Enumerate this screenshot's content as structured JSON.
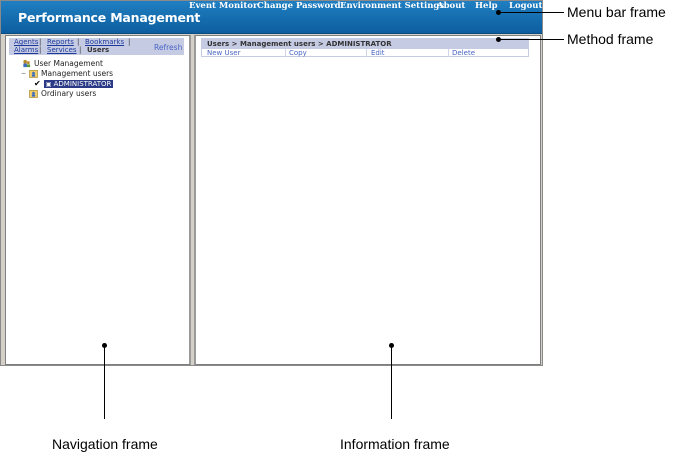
{
  "menubar": {
    "app_title": "Performance Management",
    "items": [
      "Event Monitor",
      "Change Password",
      "Environment Settings",
      "About",
      "Help",
      "Logout"
    ]
  },
  "navigation": {
    "links_row1": [
      "Agents",
      "Reports",
      "Bookmarks"
    ],
    "links_row2": [
      "Alarms",
      "Services"
    ],
    "current": "Users",
    "refresh": "Refresh",
    "tree": {
      "root": "User Management",
      "group": "Management users",
      "selected_user": "ADMINISTRATOR",
      "ordinary": "Ordinary users"
    }
  },
  "method": {
    "breadcrumb": "Users > Management users > ADMINISTRATOR",
    "actions": [
      "New User",
      "Copy",
      "Edit",
      "Delete"
    ]
  },
  "annotations": {
    "menu_bar_frame": "Menu bar frame",
    "method_frame": "Method frame",
    "navigation_frame": "Navigation frame",
    "information_frame": "Information frame"
  },
  "colors": {
    "menubar_bg": "#1071b7",
    "tab_bg": "#c6cbe4",
    "link": "#4a64c4",
    "selected_bg": "#2b3a86"
  }
}
